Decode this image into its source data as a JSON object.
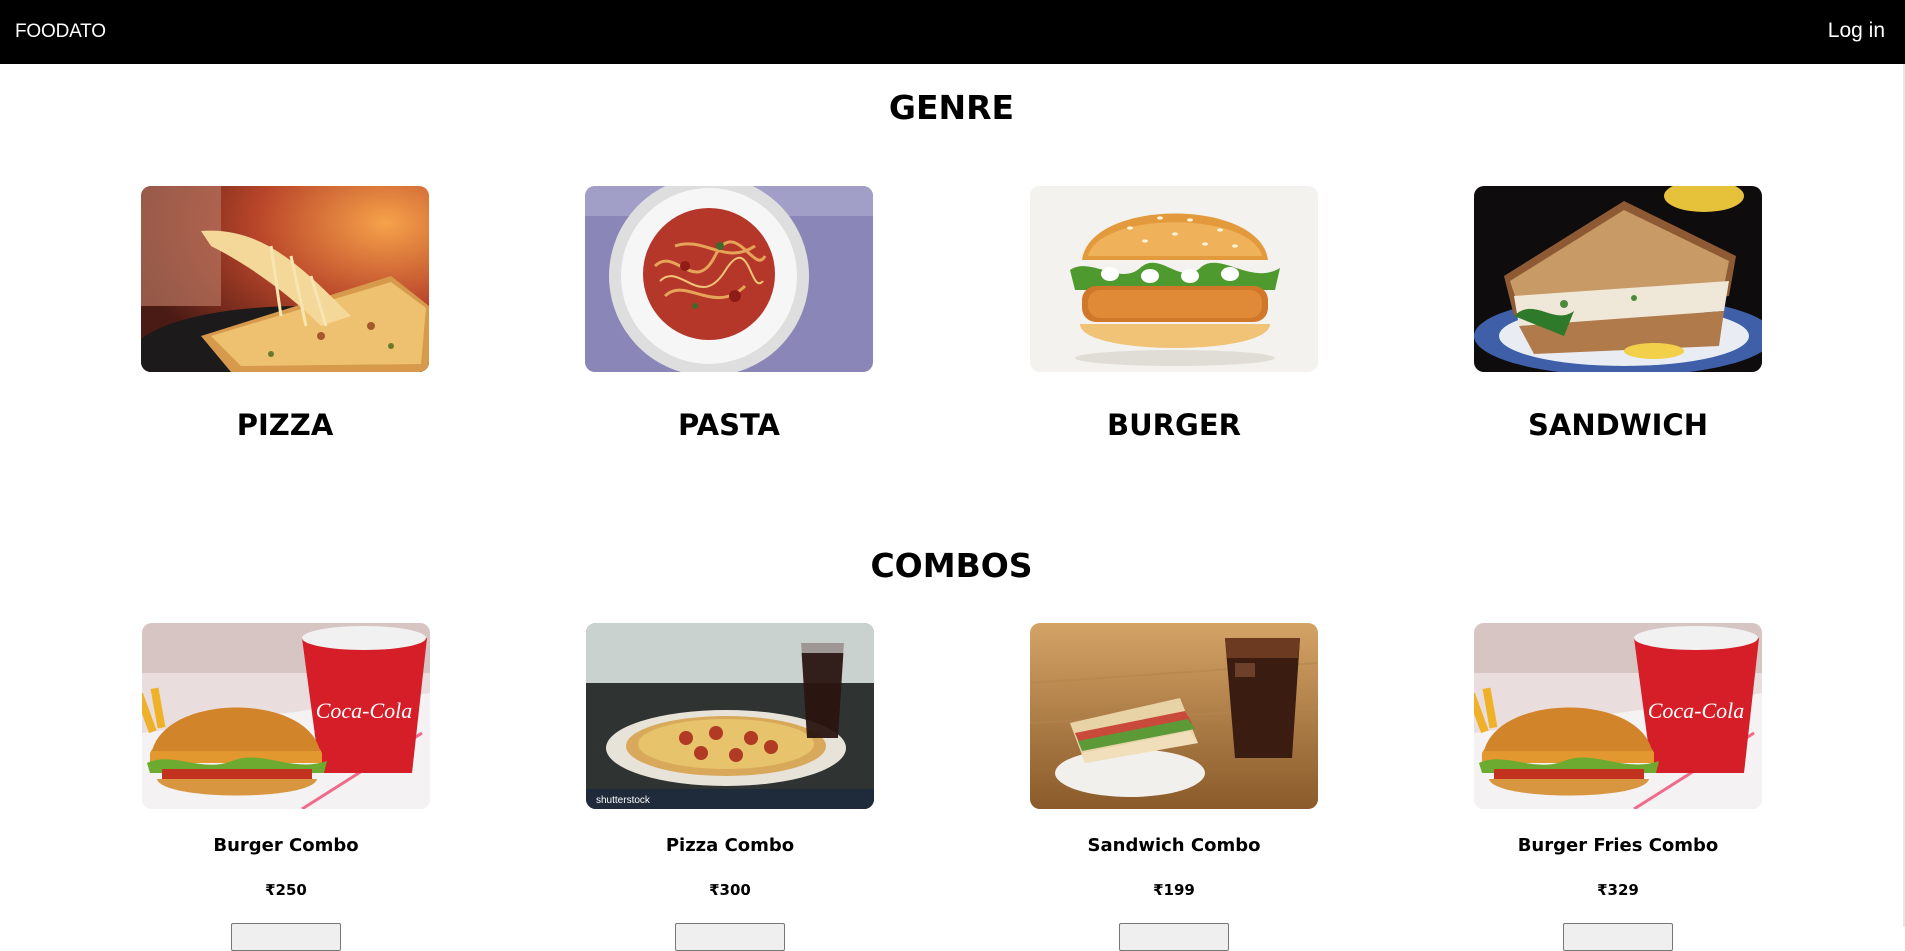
{
  "navbar": {
    "brand": "FOODATO",
    "login_label": "Log in"
  },
  "genre": {
    "title": "GENRE",
    "items": [
      {
        "label": "PIZZA",
        "image": "pizza-photo"
      },
      {
        "label": "PASTA",
        "image": "pasta-photo"
      },
      {
        "label": "BURGER",
        "image": "burger-photo"
      },
      {
        "label": "SANDWICH",
        "image": "sandwich-photo"
      }
    ]
  },
  "combos": {
    "title": "COMBOS",
    "items": [
      {
        "name": "Burger Combo",
        "price": "₹250",
        "image": "burger-combo-photo"
      },
      {
        "name": "Pizza Combo",
        "price": "₹300",
        "image": "pizza-combo-photo"
      },
      {
        "name": "Sandwich Combo",
        "price": "₹199",
        "image": "sandwich-combo-photo"
      },
      {
        "name": "Burger Fries Combo",
        "price": "₹329",
        "image": "burger-fries-combo-photo"
      }
    ]
  }
}
